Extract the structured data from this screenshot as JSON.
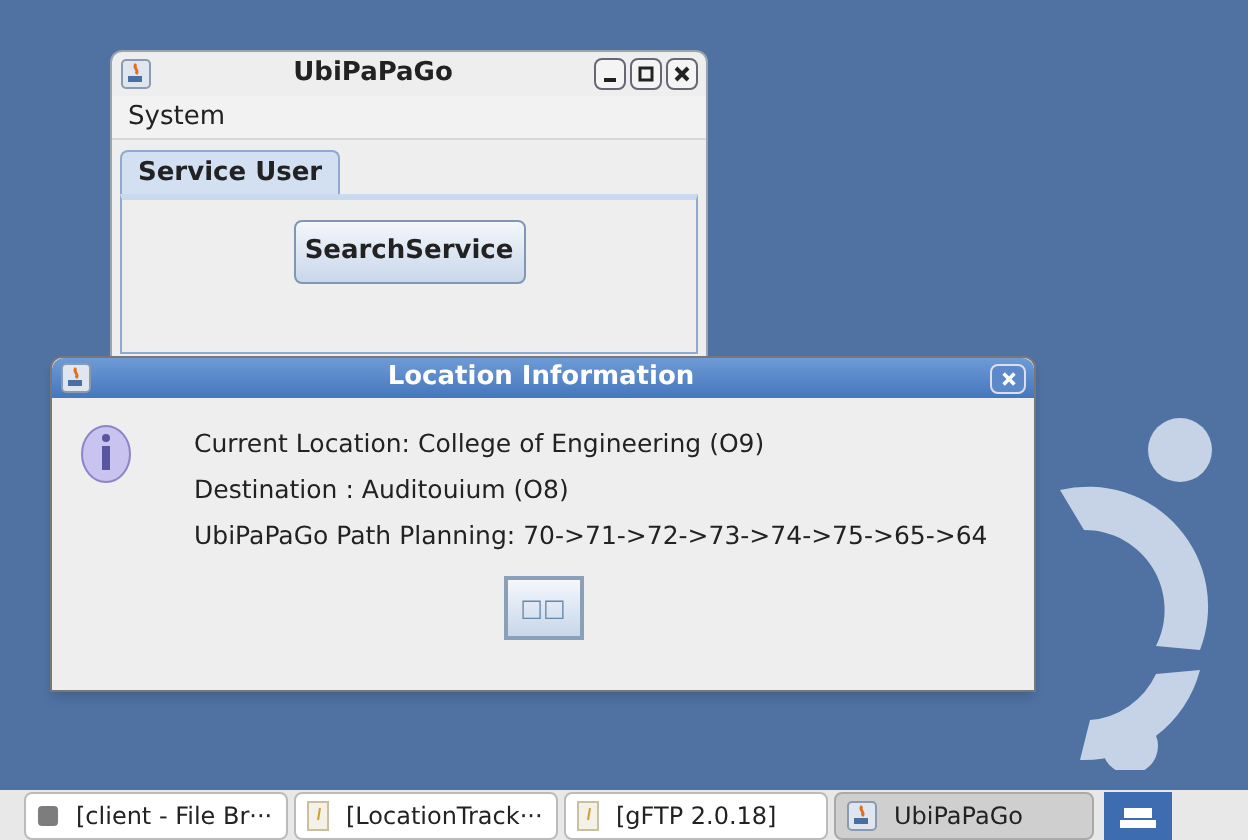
{
  "main_window": {
    "title": "UbiPaPaGo",
    "menu": [
      "System"
    ],
    "tabs": [
      {
        "label": "Service User",
        "selected": true
      }
    ],
    "button": "SearchService"
  },
  "dialog": {
    "title": "Location Information",
    "lines": [
      "Current Location: College of Engineering (O9)",
      "Destination : Auditouium (O8)",
      "UbiPaPaGo Path Planning: 70->71->72->73->74->75->65->64"
    ],
    "button": "□□"
  },
  "taskbar": {
    "items": [
      {
        "label": "[client - File Br···",
        "kind": "folder",
        "selected": false
      },
      {
        "label": "[LocationTrack···",
        "kind": "document",
        "selected": false
      },
      {
        "label": "[gFTP 2.0.18]",
        "kind": "document",
        "selected": false
      },
      {
        "label": "UbiPaPaGo",
        "kind": "java",
        "selected": true
      }
    ]
  }
}
